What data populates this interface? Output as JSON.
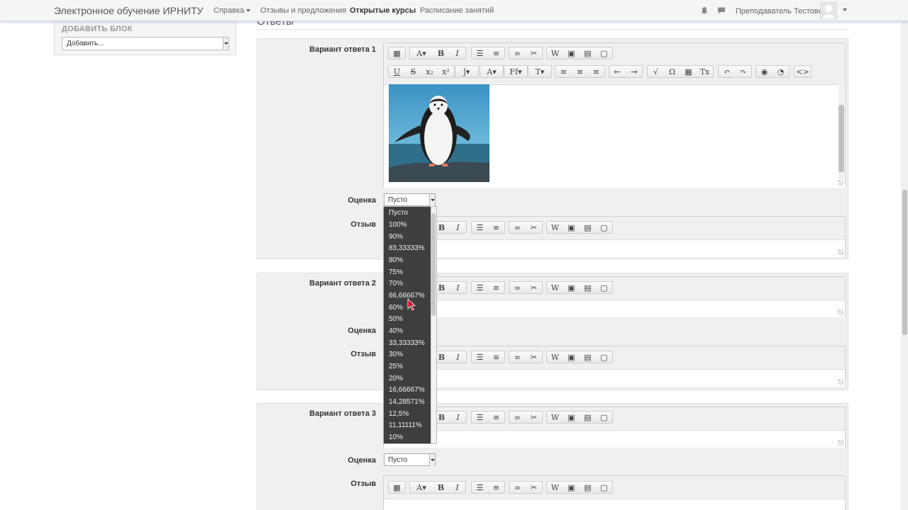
{
  "navbar": {
    "brand": "Электронное обучение ИРНИТУ",
    "items": [
      "Справка",
      "Отзывы и предложения",
      "Открытые курсы",
      "Расписание занятий"
    ],
    "user": "Преподаватель Тестовый",
    "icons": [
      "bell-icon",
      "chat-icon",
      "avatar",
      "chevron-down-icon"
    ]
  },
  "block": {
    "title": "ДОБАВИТЬ БЛОК",
    "select_value": "Добавить..."
  },
  "section_heading": "Ответы",
  "answers": [
    {
      "label": "Вариант ответа 1",
      "grade_label": "Оценка",
      "grade_value": "Пусто",
      "feedback_label": "Отзыв"
    },
    {
      "label": "Вариант ответа 2",
      "grade_label": "Оценка",
      "feedback_label": "Отзыв"
    },
    {
      "label": "Вариант ответа 3",
      "grade_label": "Оценка",
      "grade_value": "Пусто",
      "feedback_label": "Отзыв"
    }
  ],
  "dropdown_options": [
    "Пусто",
    "100%",
    "90%",
    "83,33333%",
    "80%",
    "75%",
    "70%",
    "66,66667%",
    "60%",
    "50%",
    "40%",
    "33,33333%",
    "30%",
    "25%",
    "20%",
    "16,66667%",
    "14,28571%",
    "12,5%",
    "11,11111%",
    "10%"
  ],
  "colors": {
    "dropdown_bg": "#3e3e3e",
    "fieldset_bg": "#f0f0f0",
    "navbar_bg": "#f5f5f5"
  }
}
